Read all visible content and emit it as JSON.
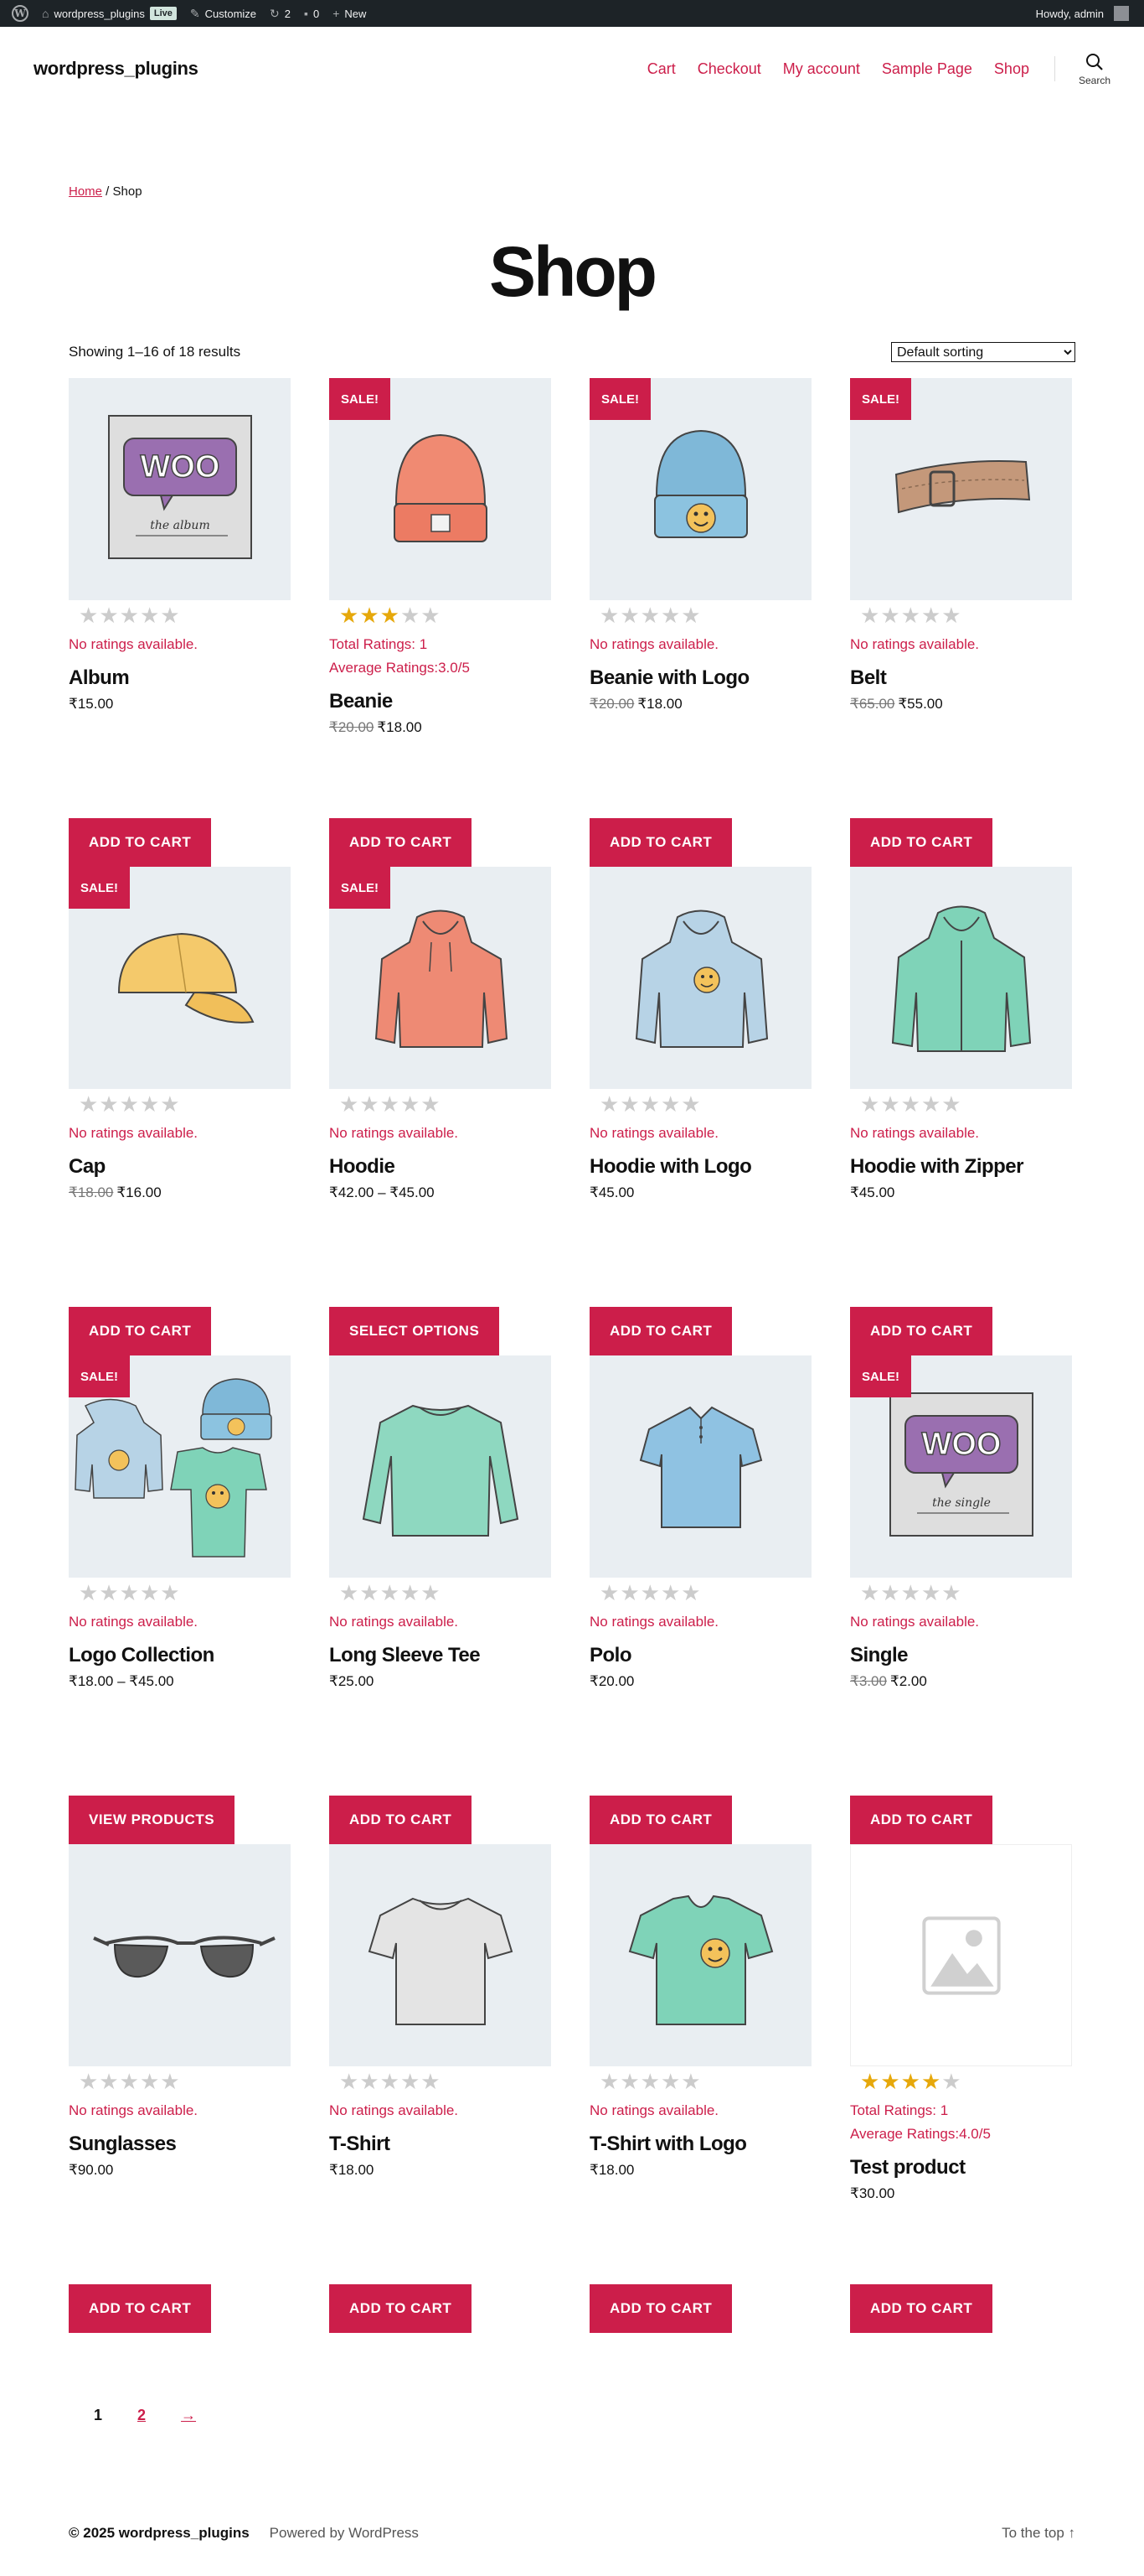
{
  "adminbar": {
    "site": "wordpress_plugins",
    "live": "Live",
    "customize": "Customize",
    "updates": "2",
    "comments": "0",
    "new": "New",
    "howdy": "Howdy, admin"
  },
  "header": {
    "site_title": "wordpress_plugins",
    "nav": [
      "Cart",
      "Checkout",
      "My account",
      "Sample Page",
      "Shop"
    ],
    "search_label": "Search"
  },
  "breadcrumb": {
    "home": "Home",
    "separator": " / ",
    "current": "Shop"
  },
  "page_title": "Shop",
  "result_count": "Showing 1–16 of 18 results",
  "sorting": {
    "selected": "Default sorting"
  },
  "sale_label": "SALE!",
  "products": [
    {
      "name": "Album",
      "sale": false,
      "stars": 0,
      "ratings": [
        "No ratings available."
      ],
      "old_price": "",
      "price": "₹15.00",
      "button": "ADD TO CART",
      "image": "album"
    },
    {
      "name": "Beanie",
      "sale": true,
      "stars": 3,
      "ratings": [
        "Total Ratings: 1",
        "Average Ratings:3.0/5"
      ],
      "old_price": "₹20.00",
      "price": "₹18.00",
      "button": "ADD TO CART",
      "image": "beanie"
    },
    {
      "name": "Beanie with Logo",
      "sale": true,
      "stars": 0,
      "ratings": [
        "No ratings available."
      ],
      "old_price": "₹20.00",
      "price": "₹18.00",
      "button": "ADD TO CART",
      "image": "beanie-logo"
    },
    {
      "name": "Belt",
      "sale": true,
      "stars": 0,
      "ratings": [
        "No ratings available."
      ],
      "old_price": "₹65.00",
      "price": "₹55.00",
      "button": "ADD TO CART",
      "image": "belt"
    },
    {
      "name": "Cap",
      "sale": true,
      "stars": 0,
      "ratings": [
        "No ratings available."
      ],
      "old_price": "₹18.00",
      "price": "₹16.00",
      "button": "ADD TO CART",
      "image": "cap"
    },
    {
      "name": "Hoodie",
      "sale": true,
      "stars": 0,
      "ratings": [
        "No ratings available."
      ],
      "old_price": "",
      "price": "₹42.00 – ₹45.00",
      "button": "SELECT OPTIONS",
      "image": "hoodie"
    },
    {
      "name": "Hoodie with Logo",
      "sale": false,
      "stars": 0,
      "ratings": [
        "No ratings available."
      ],
      "old_price": "",
      "price": "₹45.00",
      "button": "ADD TO CART",
      "image": "hoodie-logo"
    },
    {
      "name": "Hoodie with Zipper",
      "sale": false,
      "stars": 0,
      "ratings": [
        "No ratings available."
      ],
      "old_price": "",
      "price": "₹45.00",
      "button": "ADD TO CART",
      "image": "hoodie-zipper"
    },
    {
      "name": "Logo Collection",
      "sale": true,
      "stars": 0,
      "ratings": [
        "No ratings available."
      ],
      "old_price": "",
      "price": "₹18.00 – ₹45.00",
      "button": "VIEW PRODUCTS",
      "image": "logo-collection"
    },
    {
      "name": "Long Sleeve Tee",
      "sale": false,
      "stars": 0,
      "ratings": [
        "No ratings available."
      ],
      "old_price": "",
      "price": "₹25.00",
      "button": "ADD TO CART",
      "image": "long-sleeve"
    },
    {
      "name": "Polo",
      "sale": false,
      "stars": 0,
      "ratings": [
        "No ratings available."
      ],
      "old_price": "",
      "price": "₹20.00",
      "button": "ADD TO CART",
      "image": "polo"
    },
    {
      "name": "Single",
      "sale": true,
      "stars": 0,
      "ratings": [
        "No ratings available."
      ],
      "old_price": "₹3.00",
      "price": "₹2.00",
      "button": "ADD TO CART",
      "image": "single"
    },
    {
      "name": "Sunglasses",
      "sale": false,
      "stars": 0,
      "ratings": [
        "No ratings available."
      ],
      "old_price": "",
      "price": "₹90.00",
      "button": "ADD TO CART",
      "image": "sunglasses"
    },
    {
      "name": "T-Shirt",
      "sale": false,
      "stars": 0,
      "ratings": [
        "No ratings available."
      ],
      "old_price": "",
      "price": "₹18.00",
      "button": "ADD TO CART",
      "image": "tshirt"
    },
    {
      "name": "T-Shirt with Logo",
      "sale": false,
      "stars": 0,
      "ratings": [
        "No ratings available."
      ],
      "old_price": "",
      "price": "₹18.00",
      "button": "ADD TO CART",
      "image": "tshirt-logo"
    },
    {
      "name": "Test product",
      "sale": false,
      "stars": 4,
      "ratings": [
        "Total Ratings: 1",
        "Average Ratings:4.0/5"
      ],
      "old_price": "",
      "price": "₹30.00",
      "button": "ADD TO CART",
      "image": "placeholder"
    }
  ],
  "pagination": {
    "current": "1",
    "next_page": "2",
    "next_arrow": "→"
  },
  "footer": {
    "copyright": "© 2025 wordpress_plugins",
    "powered": "Powered by WordPress",
    "to_top": "To the top ↑"
  },
  "colors": {
    "accent": "#cc1e4a",
    "adminbar": "#1d2327",
    "thumb_bg": "#e9eef2",
    "star_on": "#e6a80b",
    "star_off": "#cccccc"
  }
}
